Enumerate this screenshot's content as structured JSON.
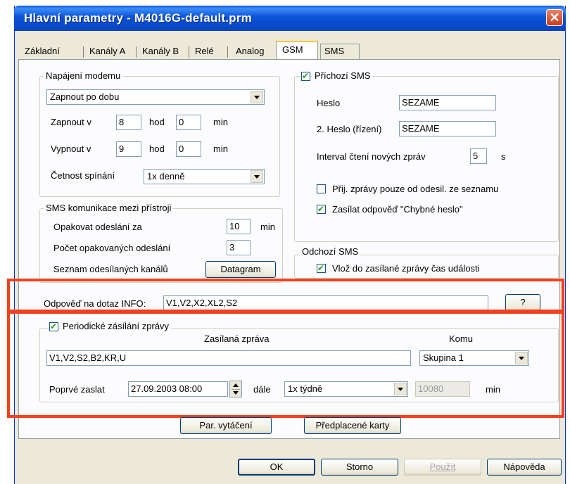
{
  "window": {
    "title": "Hlavní parametry - M4016G-default.prm",
    "close_symbol": "✕"
  },
  "tabs": [
    {
      "label": "Základní"
    },
    {
      "label": "Kanály A"
    },
    {
      "label": "Kanály B"
    },
    {
      "label": "Relé"
    },
    {
      "label": "Analog"
    },
    {
      "label": "GSM",
      "active": true
    },
    {
      "label": "SMS"
    }
  ],
  "modem": {
    "legend": "Napájení modemu",
    "mode": "Zapnout po dobu",
    "on_label": "Zapnout v",
    "on_hour": "8",
    "on_min": "0",
    "off_label": "Vypnout v",
    "off_hour": "9",
    "off_min": "0",
    "hod_label": "hod",
    "min_label": "min",
    "freq_label": "Četnost spínání",
    "freq_value": "1x denně"
  },
  "sms_comm": {
    "legend": "SMS komunikace mezi přístroji",
    "retry_label": "Opakovat odeslání za",
    "retry_value": "10",
    "retry_unit": "min",
    "count_label": "Počet opakovaných odeslání",
    "count_value": "3",
    "channels_label": "Seznam odesílaných kanálů",
    "datagram_button": "Datagram"
  },
  "incoming": {
    "legend": "Příchozí SMS",
    "checked": true,
    "password_label": "Heslo",
    "password_value": "SEZAME",
    "password2_label": "2. Heslo (řízení)",
    "password2_value": "SEZAME",
    "interval_label": "Interval čtení nových zpráv",
    "interval_value": "5",
    "interval_unit": "s",
    "only_list_label": "Přij. zprávy pouze od odesil. ze seznamu",
    "only_list_checked": false,
    "wrong_pw_label": "Zasílat odpověď \"Chybné heslo\"",
    "wrong_pw_checked": true
  },
  "outgoing": {
    "legend": "Odchozí SMS",
    "time_label": "Vlož do zasílané zprávy čas události",
    "time_checked": true
  },
  "info": {
    "label": "Odpověď na dotaz INFO:",
    "value": "V1,V2,X2,XL2,S2",
    "help_button": "?"
  },
  "periodic": {
    "legend": "Periodické zásílání zprávy",
    "checked": true,
    "message_header": "Zasílaná zpráva",
    "message_value": "V1,V2,S2,B2,KR,U",
    "to_header": "Komu",
    "to_value": "Skupina 1",
    "first_label": "Poprvé zaslat",
    "first_value": "27.09.2003 08:00",
    "then_label": "dále",
    "then_value": "1x týdně",
    "minutes_value": "10080",
    "minutes_unit": "min"
  },
  "mid_buttons": {
    "dial": "Par. vytáčení",
    "prepaid": "Předplacené karty"
  },
  "bottom_buttons": {
    "ok": "OK",
    "cancel": "Storno",
    "apply": "Použít",
    "help": "Nápověda"
  },
  "colors": {
    "highlight": "#f3411d",
    "title_bar": "#0a53d6"
  }
}
